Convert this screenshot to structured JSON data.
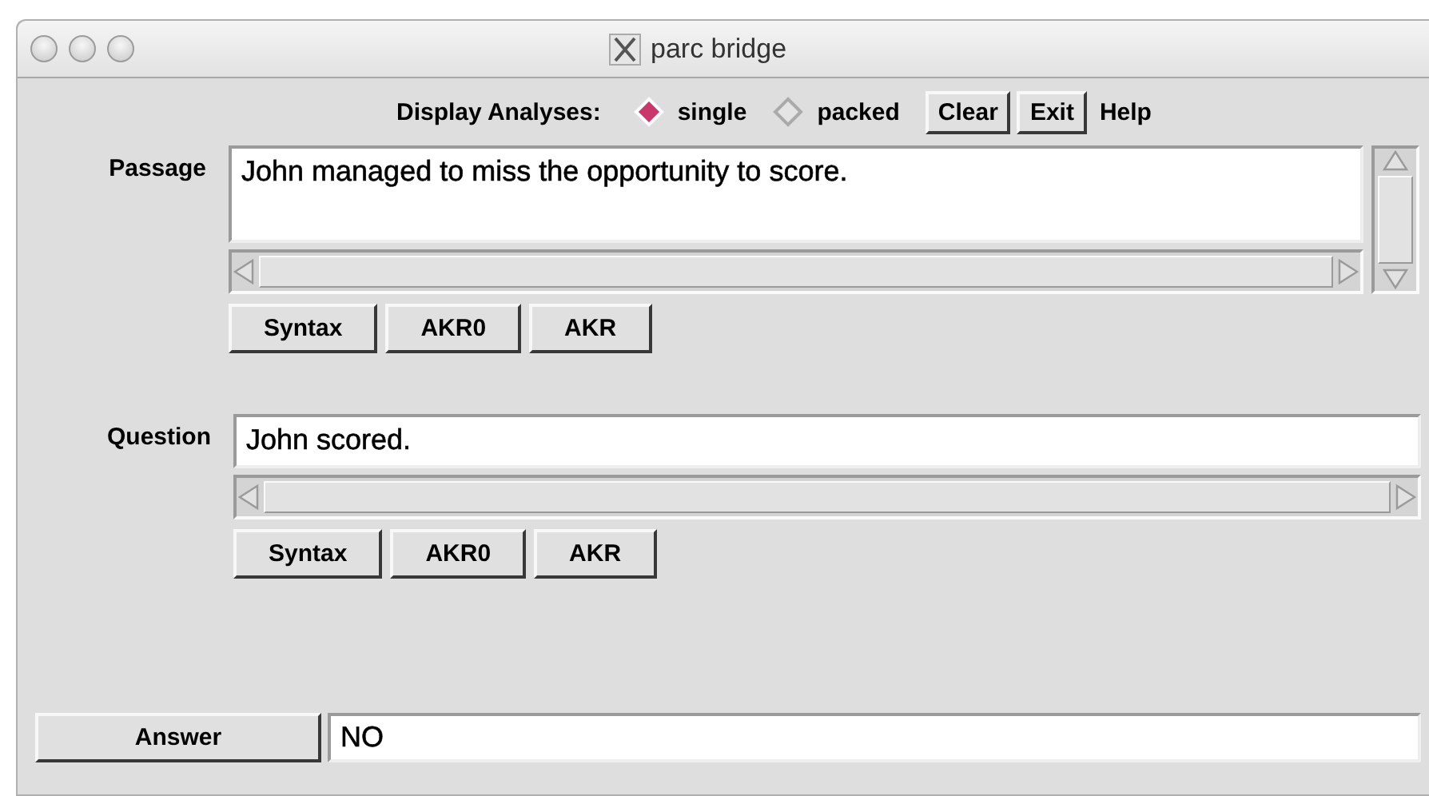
{
  "window": {
    "title": "parc bridge"
  },
  "toolbar": {
    "label": "Display Analyses:",
    "options": [
      {
        "label": "single",
        "selected": true
      },
      {
        "label": "packed",
        "selected": false
      }
    ],
    "buttons": [
      {
        "label": "Clear",
        "kind": "button"
      },
      {
        "label": "Exit",
        "kind": "button"
      },
      {
        "label": "Help",
        "kind": "menu"
      }
    ]
  },
  "passage": {
    "label": "Passage",
    "value": "John managed to miss the opportunity to score.",
    "buttons": [
      "Syntax",
      "AKR0",
      "AKR"
    ]
  },
  "question": {
    "label": "Question",
    "value": "John scored.",
    "buttons": [
      "Syntax",
      "AKR0",
      "AKR"
    ]
  },
  "answer": {
    "button": "Answer",
    "value": "NO"
  }
}
